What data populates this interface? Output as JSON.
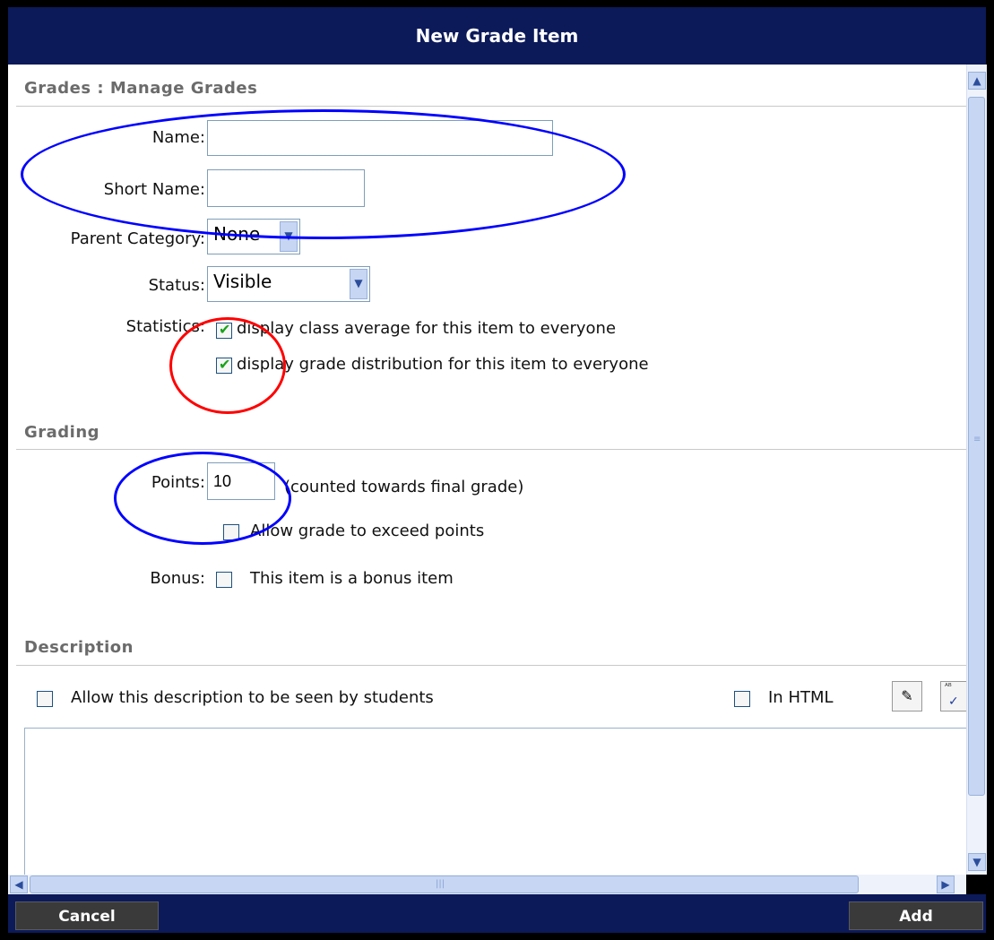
{
  "dialog": {
    "title": "New Grade Item"
  },
  "sections": {
    "manage": "Grades : Manage Grades",
    "grading": "Grading",
    "description": "Description"
  },
  "fields": {
    "name_label": "Name:",
    "name_value": "",
    "short_name_label": "Short Name:",
    "short_name_value": "",
    "parent_category_label": "Parent Category:",
    "parent_category_value": "None",
    "status_label": "Status:",
    "status_value": "Visible",
    "statistics_label": "Statistics:",
    "stat_class_average": "display class average for this item to everyone",
    "stat_class_average_checked": true,
    "stat_distribution": "display grade distribution for this item to everyone",
    "stat_distribution_checked": true,
    "points_label": "Points:",
    "points_value": "10",
    "points_note": "(counted towards final grade)",
    "exceed_label": "Allow grade to exceed points",
    "exceed_checked": false,
    "bonus_label": "Bonus:",
    "bonus_text": "This item is a bonus item",
    "bonus_checked": false,
    "desc_visible_label": "Allow this description to be seen by students",
    "desc_visible_checked": false,
    "in_html_label": "In HTML",
    "in_html_checked": false
  },
  "footer": {
    "cancel": "Cancel",
    "add": "Add"
  },
  "colors": {
    "header_bg": "#0c1a5a",
    "annotation_blue": "#0000ff",
    "annotation_red": "#ff0000"
  }
}
